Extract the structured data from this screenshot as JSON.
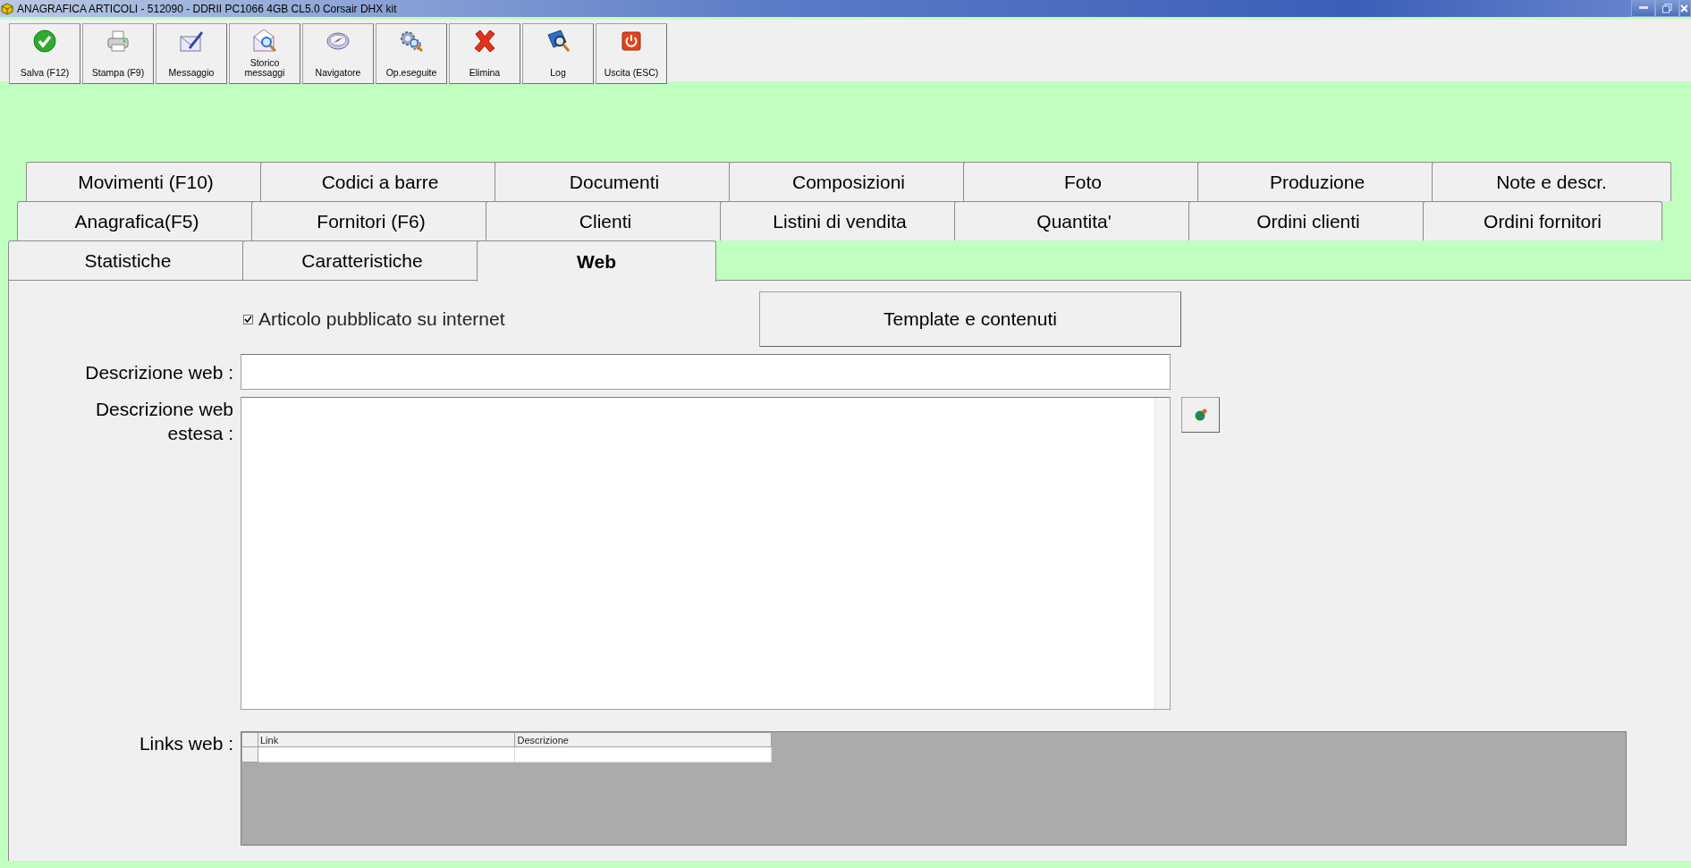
{
  "window": {
    "title": "ANAGRAFICA ARTICOLI - 512090 - DDRII PC1066 4GB CL5.0 Corsair DHX kit"
  },
  "toolbar": [
    {
      "label": "Salva (F12)"
    },
    {
      "label": "Stampa (F9)"
    },
    {
      "label": "Messaggio"
    },
    {
      "label": "Storico messaggi"
    },
    {
      "label": "Navigatore"
    },
    {
      "label": "Op.eseguite"
    },
    {
      "label": "Elimina"
    },
    {
      "label": "Log"
    },
    {
      "label": "Uscita (ESC)"
    }
  ],
  "tab_rows": [
    [
      {
        "label": "Movimenti (F10)",
        "selected": false
      },
      {
        "label": "Codici a barre",
        "selected": false
      },
      {
        "label": "Documenti",
        "selected": false
      },
      {
        "label": "Composizioni",
        "selected": false
      },
      {
        "label": "Foto",
        "selected": false
      },
      {
        "label": "Produzione",
        "selected": false
      },
      {
        "label": "Note e descr.",
        "selected": false
      }
    ],
    [
      {
        "label": "Anagrafica(F5)",
        "selected": false
      },
      {
        "label": "Fornitori (F6)",
        "selected": false
      },
      {
        "label": "Clienti",
        "selected": false
      },
      {
        "label": "Listini di vendita",
        "selected": false
      },
      {
        "label": "Quantita'",
        "selected": false
      },
      {
        "label": "Ordini clienti",
        "selected": false
      },
      {
        "label": "Ordini fornitori",
        "selected": false
      }
    ],
    [
      {
        "label": "Statistiche",
        "selected": false
      },
      {
        "label": "Caratteristiche",
        "selected": false
      },
      {
        "label": "Web",
        "selected": true
      }
    ]
  ],
  "web": {
    "published": {
      "label": "Articolo pubblicato su internet",
      "checked": true
    },
    "template_button": "Template e contenuti",
    "description_label": "Descrizione web :",
    "extended_label": "Descrizione web estesa :",
    "links_label": "Links web :",
    "links_table": {
      "columns": [
        "Link",
        "Descrizione"
      ]
    }
  }
}
